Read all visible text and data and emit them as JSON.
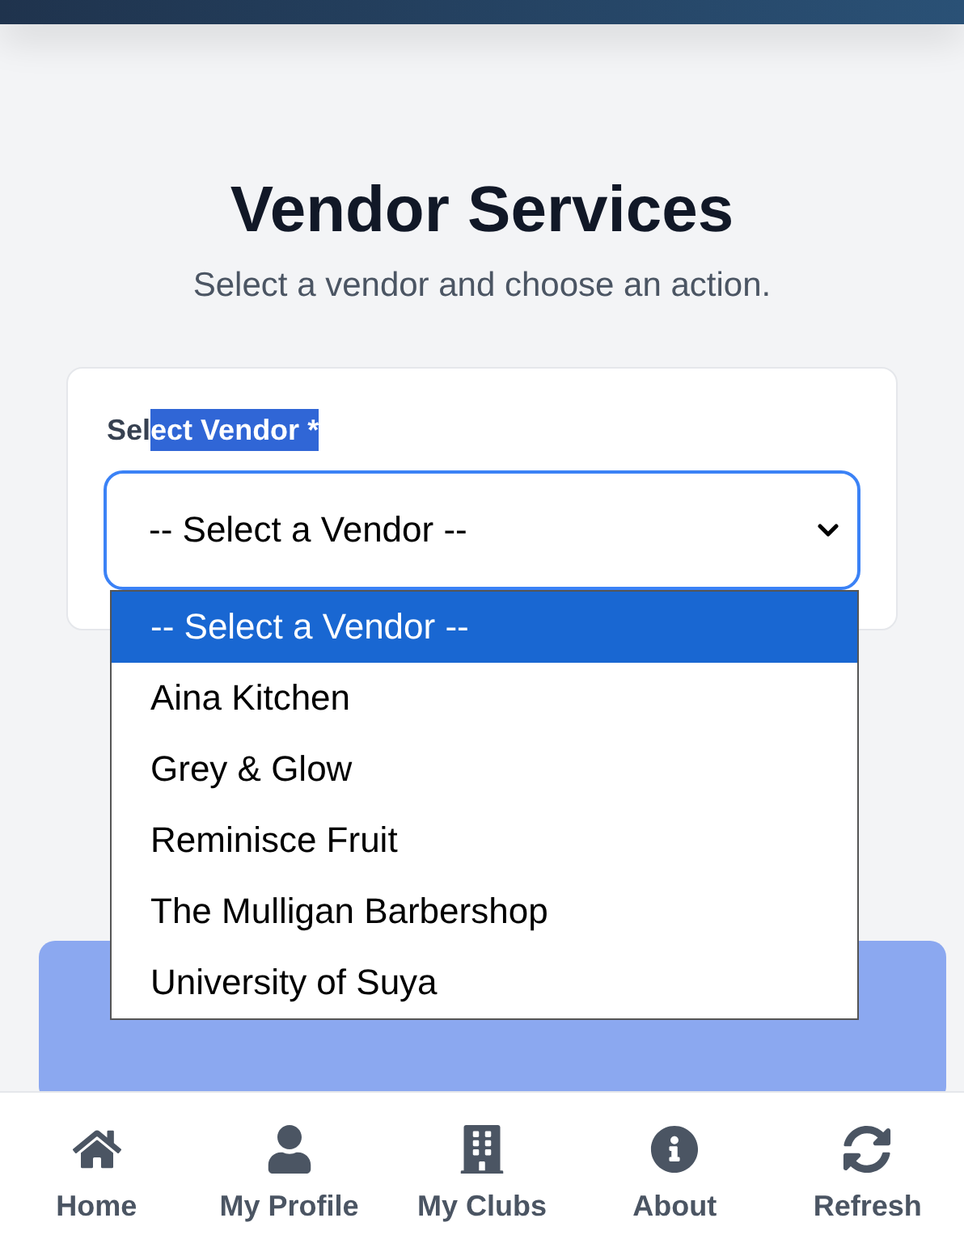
{
  "page": {
    "title": "Vendor Services",
    "subtitle": "Select a vendor and choose an action."
  },
  "vendor_field": {
    "label_parts": [
      {
        "text": "Sel",
        "highlighted": false
      },
      {
        "text": "ect Vendor *",
        "highlighted": true
      }
    ],
    "value": "-- Select a Vendor --",
    "focused": true,
    "expanded": true,
    "options": [
      {
        "label": "-- Select a Vendor --",
        "selected": true
      },
      {
        "label": "Aina Kitchen",
        "selected": false
      },
      {
        "label": "Grey & Glow",
        "selected": false
      },
      {
        "label": "Reminisce Fruit",
        "selected": false
      },
      {
        "label": "The Mulligan Barbershop",
        "selected": false
      },
      {
        "label": "University of Suya",
        "selected": false
      }
    ]
  },
  "bottom_nav": [
    {
      "kind": "home",
      "label": "Home"
    },
    {
      "kind": "profile",
      "label": "My Profile"
    },
    {
      "kind": "clubs",
      "label": "My Clubs"
    },
    {
      "kind": "about",
      "label": "About"
    },
    {
      "kind": "refresh",
      "label": "Refresh"
    }
  ]
}
